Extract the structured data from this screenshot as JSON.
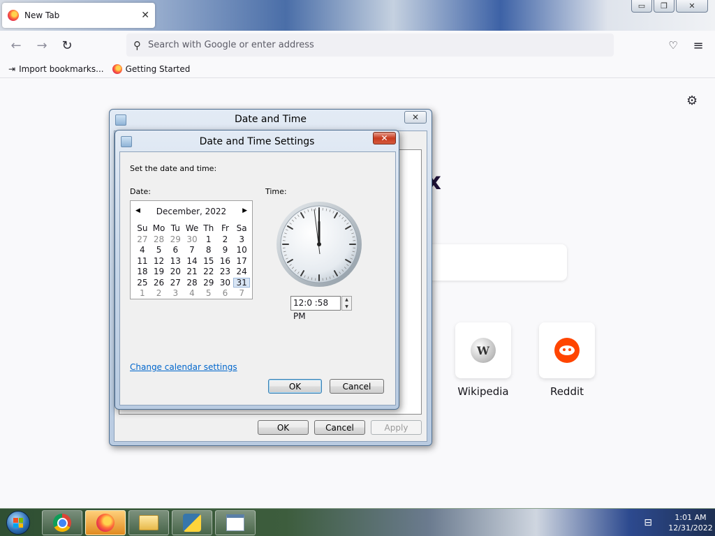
{
  "browser": {
    "tab_title": "New Tab",
    "tab_close": "✕",
    "url_placeholder": "Search with Google or enter address",
    "bookmarks": [
      {
        "label": "Import bookmarks..."
      },
      {
        "label": "Getting Started"
      }
    ]
  },
  "window_controls": {
    "minimize": "▭",
    "restore": "❐",
    "close": "✕"
  },
  "new_tab": {
    "partial_logo_text": "x",
    "shortcuts": [
      {
        "label": "Wikipedia",
        "glyph": "W"
      },
      {
        "label": "Reddit"
      }
    ]
  },
  "outer_dialog": {
    "title": "Date and Time",
    "close": "✕",
    "ok": "OK",
    "cancel": "Cancel",
    "apply": "Apply"
  },
  "inner_dialog": {
    "title": "Date and Time Settings",
    "close": "✕",
    "instruction": "Set the date and time:",
    "date_label": "Date:",
    "time_label": "Time:",
    "calendar": {
      "month_year": "December, 2022",
      "prev": "◀",
      "next": "▶",
      "weekdays": [
        "Su",
        "Mo",
        "Tu",
        "We",
        "Th",
        "Fr",
        "Sa"
      ],
      "weeks": [
        [
          "27",
          "28",
          "29",
          "30",
          "1",
          "2",
          "3"
        ],
        [
          "4",
          "5",
          "6",
          "7",
          "8",
          "9",
          "10"
        ],
        [
          "11",
          "12",
          "13",
          "14",
          "15",
          "16",
          "17"
        ],
        [
          "18",
          "19",
          "20",
          "21",
          "22",
          "23",
          "24"
        ],
        [
          "25",
          "26",
          "27",
          "28",
          "29",
          "30",
          "31"
        ],
        [
          "1",
          "2",
          "3",
          "4",
          "5",
          "6",
          "7"
        ]
      ],
      "selected_day": "31"
    },
    "time_value": "12:0 :58 PM",
    "change_calendar_link": "Change calendar settings",
    "ok": "OK",
    "cancel": "Cancel"
  },
  "taskbar": {
    "apps": [
      "chrome-icon",
      "firefox-icon",
      "file-explorer-icon",
      "python-icon",
      "date-time-icon"
    ],
    "clock_time": "1:01 AM",
    "clock_date": "12/31/2022"
  }
}
